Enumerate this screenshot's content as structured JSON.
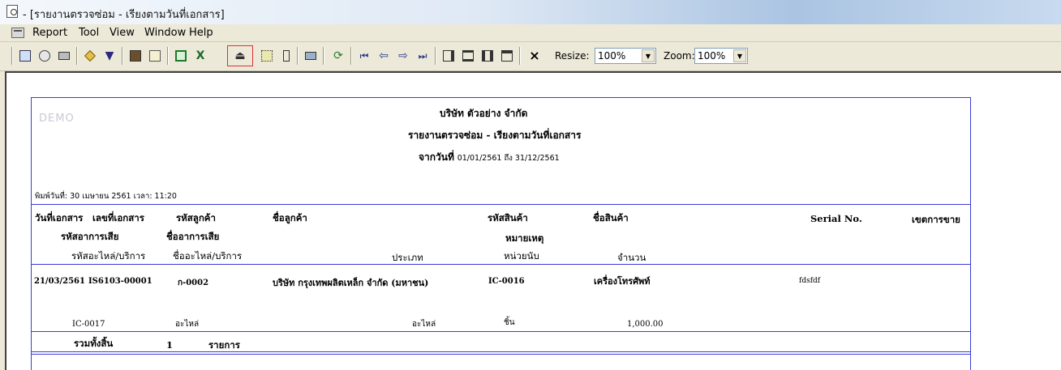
{
  "window": {
    "title": "- [รายงานตรวจซ่อม - เรียงตามวันที่เอกสาร]"
  },
  "menu": [
    "Report",
    "Tool",
    "View",
    "Window",
    "Help"
  ],
  "toolbar": {
    "resize_label": "Resize:",
    "resize_value": "100%",
    "zoom_label": "Zoom:",
    "zoom_value": "100%",
    "close_glyph": "×"
  },
  "report": {
    "watermark": "DEMO",
    "company": "บริษัท ตัวอย่าง จำกัด",
    "title": "รายงานตรวจซ่อม - เรียงตามวันที่เอกสาร",
    "range_prefix": "จากวันที่",
    "range_value": "01/01/2561 ถึง 31/12/2561",
    "print_info": "พิมพ์วันที่: 30 เมษายน 2561 เวลา: 11:20",
    "headers": {
      "doc_date": "วันที่เอกสาร",
      "doc_no": "เลขที่เอกสาร",
      "customer_code": "รหัสลูกค้า",
      "customer_name": "ชื่อลูกค้า",
      "product_code": "รหัสสินค้า",
      "product_name": "ชื่อสินค้า",
      "serial_no": "Serial No.",
      "sales_area": "เขตการขาย",
      "symptom_code": "รหัสอาการเสีย",
      "symptom_name": "ชื่ออาการเสีย",
      "remark": "หมายเหตุ",
      "part_code": "รหัสอะไหล่/บริการ",
      "part_name": "ชื่ออะไหล่/บริการ",
      "type": "ประเภท",
      "unit": "หน่วยนับ",
      "qty": "จำนวน"
    },
    "row": {
      "doc_date": "21/03/2561",
      "doc_no": "IS6103-00001",
      "customer_code": "ก-0002",
      "customer_name": "บริษัท กรุงเทพผลิตเหล็ก จำกัด (มหาชน)",
      "product_code": "IC-0016",
      "product_name": "เครื่องโทรศัพท์",
      "serial_no": "fdsfdf"
    },
    "part_row": {
      "part_code": "IC-0017",
      "part_name": "อะไหล่",
      "type": "อะไหล่",
      "unit": "ชิ้น",
      "qty": "1,000.00"
    },
    "total": {
      "label": "รวมทั้งสิ้น",
      "count": "1",
      "unit": "รายการ"
    }
  }
}
